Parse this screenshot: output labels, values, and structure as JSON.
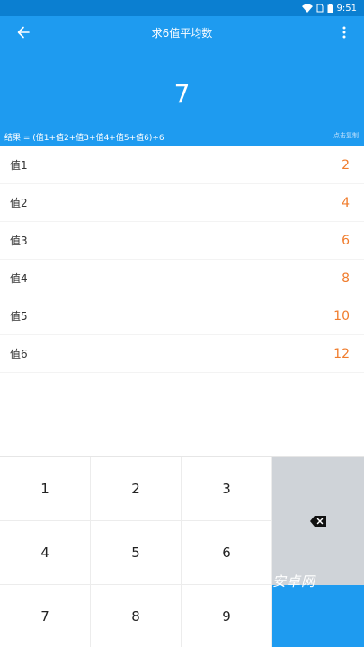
{
  "status_bar": {
    "time": "9:51",
    "icons": [
      "wifi-icon",
      "sim-icon",
      "battery-icon"
    ]
  },
  "header": {
    "title": "求6值平均数",
    "result": "7",
    "formula": "结果 = (值1+值2+值3+值4+值5+值6)÷6",
    "copy_hint": "点击复制"
  },
  "values": [
    {
      "label": "值1",
      "value": "2"
    },
    {
      "label": "值2",
      "value": "4"
    },
    {
      "label": "值3",
      "value": "6"
    },
    {
      "label": "值4",
      "value": "8"
    },
    {
      "label": "值5",
      "value": "10"
    },
    {
      "label": "值6",
      "value": "12"
    }
  ],
  "keypad": {
    "keys": [
      "1",
      "2",
      "3",
      "4",
      "5",
      "6",
      "7",
      "8",
      "9"
    ],
    "delete_icon": "backspace-icon"
  },
  "watermark": "安卓网",
  "colors": {
    "primary": "#1e9bf0",
    "status_bar": "#0b7fd1",
    "value": "#f07c2c",
    "delete_key": "#cfd3d8"
  }
}
